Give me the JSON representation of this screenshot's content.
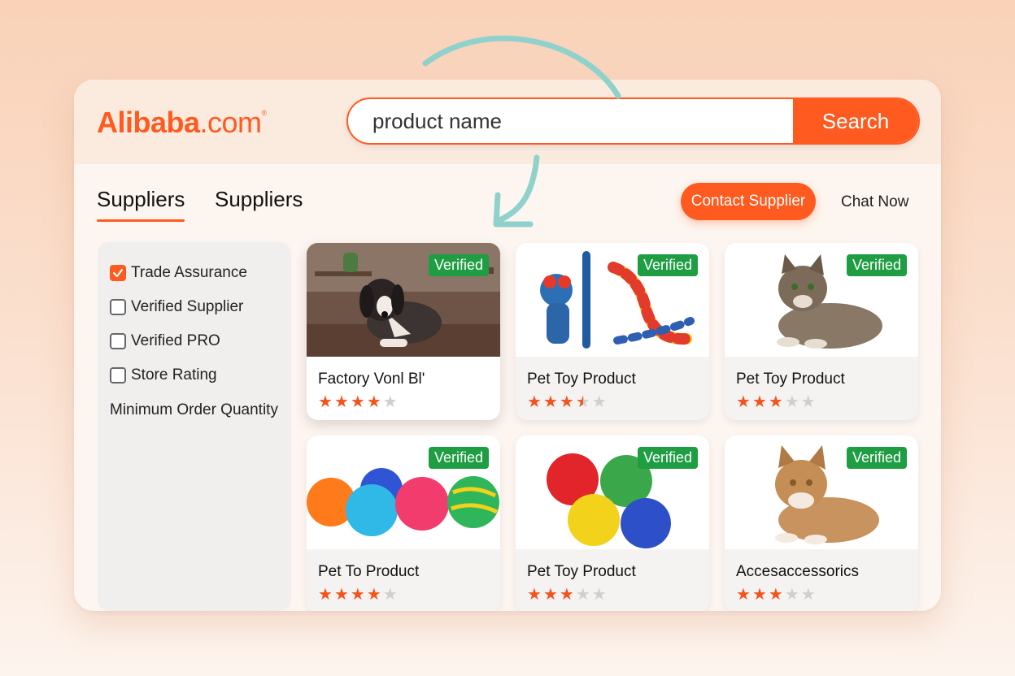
{
  "brand": {
    "name": "Alibaba",
    "suffix": ".com",
    "mark": "®"
  },
  "search": {
    "value": "product name",
    "button_label": "Search"
  },
  "tabs": [
    {
      "label": "Suppliers"
    },
    {
      "label": "Suppliers"
    }
  ],
  "actions": {
    "contact_label": "Contact Supplier",
    "chat_label": "Chat Now"
  },
  "filters": [
    {
      "label": "Trade Assurance",
      "checked": true
    },
    {
      "label": "Verified Supplier",
      "checked": false
    },
    {
      "label": "Verified PRO",
      "checked": false
    },
    {
      "label": "Store Rating",
      "checked": false
    }
  ],
  "filter_extra": "Minimum Order Quantity",
  "products": [
    {
      "title": "Factory Vonl Bl'",
      "badge": "Verified",
      "rating": 4,
      "image": "dog-photo"
    },
    {
      "title": "Pet Toy Product",
      "badge": "Verified",
      "rating": 3.5,
      "image": "rope-toy-photo"
    },
    {
      "title": "Pet Toy Product",
      "badge": "Verified",
      "rating": 3,
      "image": "tabby-cat-photo"
    },
    {
      "title": "Pet To Product",
      "badge": "Verified",
      "rating": 4,
      "image": "colored-balls-photo"
    },
    {
      "title": "Pet Toy Product",
      "badge": "Verified",
      "rating": 3,
      "image": "rubber-balls-photo"
    },
    {
      "title": "Accesaccessorics",
      "badge": "Verified",
      "rating": 3,
      "image": "ginger-cat-photo"
    }
  ],
  "colors": {
    "accent": "#ff5a1f",
    "verified": "#1e9d43",
    "arrow": "#8fd1cb",
    "star_on": "#f2541b",
    "star_off": "#cfcfcf"
  }
}
